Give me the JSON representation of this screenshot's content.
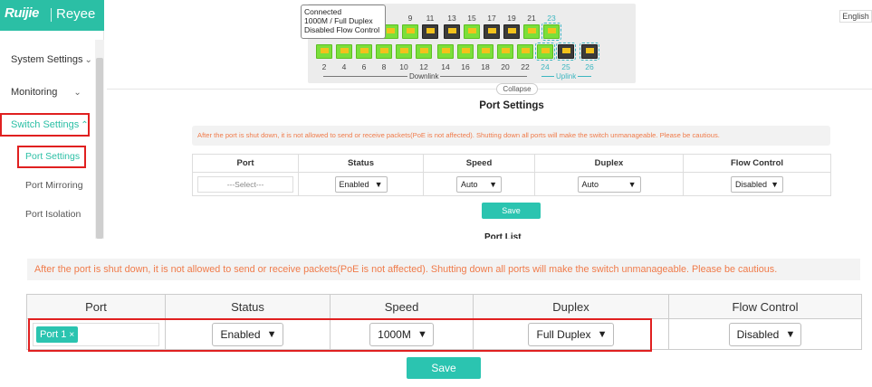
{
  "brand": {
    "name1": "Ruijie",
    "name2": "Reyee"
  },
  "language": "English",
  "sidebar": {
    "items": [
      {
        "label": "System Settings"
      },
      {
        "label": "Monitoring"
      },
      {
        "label": "Switch Settings"
      }
    ],
    "subitems": [
      {
        "label": "Port Settings"
      },
      {
        "label": "Port Mirroring"
      },
      {
        "label": "Port Isolation"
      }
    ]
  },
  "switch_panel": {
    "tooltip_lines": [
      "Connected",
      "1000M / Full Duplex",
      "Disabled Flow Control"
    ],
    "top_port_numbers": [
      "9",
      "11",
      "13",
      "15",
      "17",
      "19",
      "21",
      "23"
    ],
    "bottom_port_numbers": [
      "2",
      "4",
      "6",
      "8",
      "10",
      "12",
      "14",
      "16",
      "18",
      "20",
      "22",
      "24",
      "25",
      "26"
    ],
    "downlink_label": "Downlink",
    "uplink_label": "Uplink",
    "collapse_label": "Collapse",
    "colors": {
      "connected": "#7bdf3a",
      "disconnected": "#3b3b3b",
      "selected_outline": "#3cb6c0"
    }
  },
  "settings": {
    "title": "Port Settings",
    "warning": "After the port is shut down, it is not allowed to send or receive packets(PoE is not affected). Shutting down all ports will make the switch unmanageable. Please be cautious.",
    "columns": [
      "Port",
      "Status",
      "Speed",
      "Duplex",
      "Flow Control"
    ],
    "port_placeholder": "---Select---",
    "status": "Enabled",
    "speed": "Auto",
    "duplex": "Auto",
    "flow_control": "Disabled",
    "save_label": "Save",
    "port_list_title": "Port List"
  },
  "zoomed": {
    "warning": "After the port is shut down, it is not allowed to send or receive packets(PoE is not affected). Shutting down all ports will make the switch unmanageable. Please be cautious.",
    "columns": [
      "Port",
      "Status",
      "Speed",
      "Duplex",
      "Flow Control"
    ],
    "port_tag": "Port 1",
    "port_tag_remove": "×",
    "status": "Enabled",
    "speed": "1000M",
    "duplex": "Full Duplex",
    "flow_control": "Disabled",
    "save_label": "Save",
    "accent_color": "#2bc4b0",
    "highlight_color": "#e02020"
  }
}
